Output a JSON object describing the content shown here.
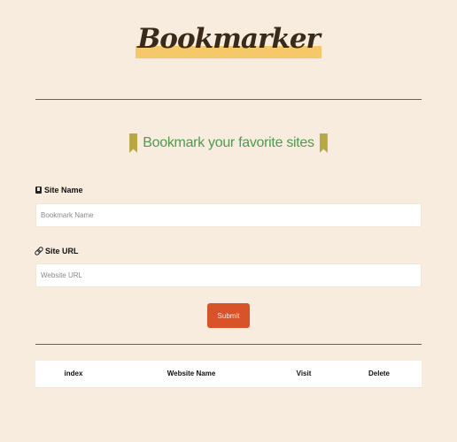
{
  "header": {
    "logo_text": "Bookmarker"
  },
  "form": {
    "heading": "Bookmark your favorite sites",
    "site_name": {
      "label": "Site Name",
      "placeholder": "Bookmark Name",
      "value": ""
    },
    "site_url": {
      "label": "Site URL",
      "placeholder": "Website URL",
      "value": ""
    },
    "submit_label": "Submit"
  },
  "table": {
    "columns": [
      "index",
      "Website Name",
      "Visit",
      "Delete"
    ],
    "rows": []
  },
  "colors": {
    "background": "#f8ecdf",
    "accent_green": "#4f9a4f",
    "bookmark_icon": "#b8a844",
    "submit_button": "#d9532a",
    "logo_highlight": "#f5c86a"
  },
  "icons": {
    "heading_icons": "bookmark-icon",
    "site_name_icon": "book-icon",
    "site_url_icon": "link-icon"
  }
}
